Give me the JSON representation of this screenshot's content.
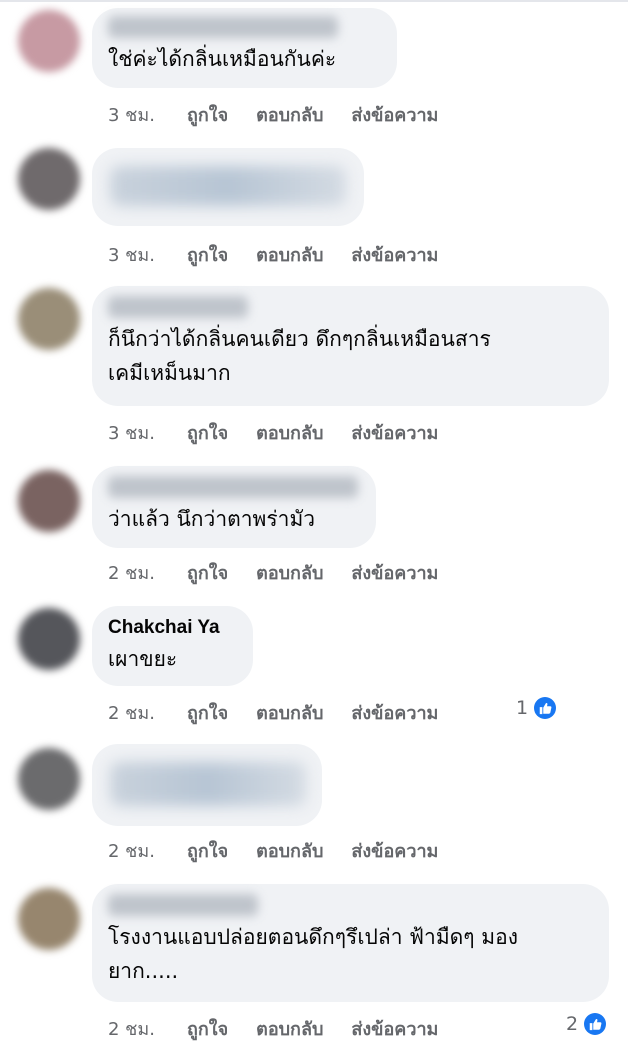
{
  "labels": {
    "like": "ถูกใจ",
    "reply": "ตอบกลับ",
    "message": "ส่งข้อความ"
  },
  "icons": {
    "reaction": "like-reaction-icon"
  },
  "colors": {
    "bubble": "#f0f2f5",
    "meta": "#65676b",
    "like": "#1877f2"
  },
  "comments": [
    {
      "name": "",
      "text": "ใช่ค่ะได้กลิ่นเหมือนกันค่ะ",
      "time": "3 ชม.",
      "likes": ""
    },
    {
      "name": "",
      "text": "",
      "time": "3 ชม.",
      "likes": ""
    },
    {
      "name": "",
      "text": "ก็นึกว่าได้กลิ่นคนเดียว ดึกๆกลิ่นเหมือนสาร\nเคมีเหม็นมาก",
      "time": "3 ชม.",
      "likes": ""
    },
    {
      "name": "",
      "text": "ว่าแล้ว นึกว่าตาพร่ามัว",
      "time": "2 ชม.",
      "likes": ""
    },
    {
      "name": "Chakchai Ya",
      "text": "เผาขยะ",
      "time": "2 ชม.",
      "likes": "1"
    },
    {
      "name": "",
      "text": "",
      "time": "2 ชม.",
      "likes": ""
    },
    {
      "name": "",
      "text": "โรงงานแอบปล่อยตอนดึกๆรึเปล่า ฟ้ามืดๆ มอง\nยาก.....",
      "time": "2 ชม.",
      "likes": "2"
    }
  ]
}
